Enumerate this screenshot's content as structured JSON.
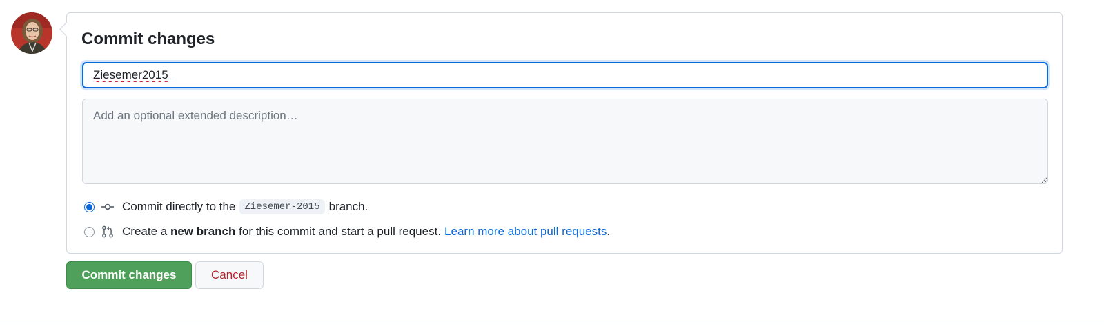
{
  "avatar": {
    "alt": "user avatar"
  },
  "form": {
    "title": "Commit changes",
    "summary_value": "Ziesemer2015",
    "description_placeholder": "Add an optional extended description…"
  },
  "options": {
    "direct": {
      "selected": true,
      "prefix": "Commit directly to the",
      "branch": "Ziesemer-2015",
      "suffix": "branch.",
      "icon": "git-commit-icon"
    },
    "new_branch": {
      "selected": false,
      "prefix": "Create a",
      "bold": "new branch",
      "suffix": "for this commit and start a pull request.",
      "link": "Learn more about pull requests",
      "trailing": ".",
      "icon": "git-pull-request-icon"
    }
  },
  "buttons": {
    "commit": "Commit changes",
    "cancel": "Cancel"
  },
  "colors": {
    "commit_green": "#4fa05a",
    "cancel_red": "#b3262d",
    "link_blue": "#0969da"
  }
}
